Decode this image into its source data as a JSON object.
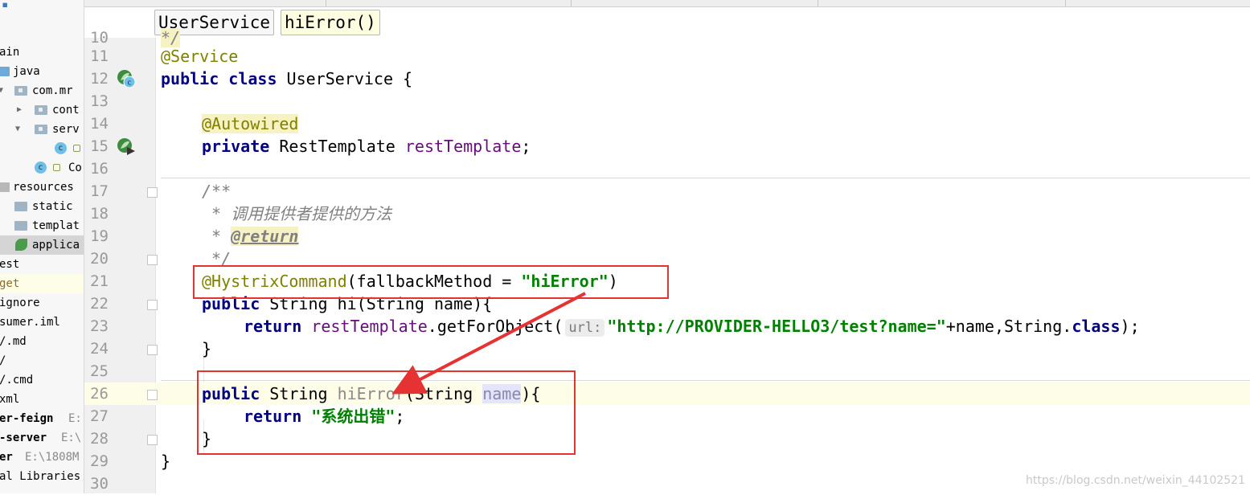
{
  "project_tree": [
    {
      "label": "ain",
      "icon": "none",
      "bold": false
    },
    {
      "label": "java",
      "icon": "source-folder-icon",
      "bold": false
    },
    {
      "label": "com.mr",
      "icon": "package-icon",
      "bold": false
    },
    {
      "label": "cont",
      "icon": "package-icon",
      "bold": false
    },
    {
      "label": "serv",
      "icon": "package-icon",
      "bold": false
    },
    {
      "label": "",
      "icon": "class-icon",
      "bold": false
    },
    {
      "label": "Co",
      "icon": "spring-boot-class-icon",
      "bold": false
    },
    {
      "label": "resources",
      "icon": "resources-folder-icon",
      "bold": false
    },
    {
      "label": "static",
      "icon": "folder-icon",
      "bold": false
    },
    {
      "label": "templat",
      "icon": "folder-icon",
      "bold": false
    },
    {
      "label": "applica",
      "icon": "spring-config-icon",
      "bold": false
    },
    {
      "label": "est",
      "icon": "none",
      "bold": false
    },
    {
      "label": "get",
      "icon": "none",
      "bold": false
    },
    {
      "label": "ignore",
      "icon": "none",
      "bold": false
    },
    {
      "label": "sumer.iml",
      "icon": "none",
      "bold": false
    },
    {
      "label": "/.md",
      "icon": "none",
      "bold": false
    },
    {
      "label": "/",
      "icon": "none",
      "bold": false
    },
    {
      "label": "/.cmd",
      "icon": "none",
      "bold": false
    },
    {
      "label": "xml",
      "icon": "none",
      "bold": false
    },
    {
      "label": "er-feign",
      "icon": "none",
      "bold": true,
      "path": "E:"
    },
    {
      "label": "-server",
      "icon": "none",
      "bold": true,
      "path": "E:\\"
    },
    {
      "label": "er",
      "icon": "none",
      "bold": true,
      "path": "E:\\1808M"
    },
    {
      "label": "al Libraries",
      "icon": "none",
      "bold": false
    }
  ],
  "breadcrumb": {
    "class_name": "UserService",
    "method_name": "hiError()"
  },
  "line_numbers": [
    "10",
    "11",
    "12",
    "13",
    "14",
    "15",
    "16",
    "17",
    "18",
    "19",
    "20",
    "21",
    "22",
    "23",
    "24",
    "25",
    "26",
    "27",
    "28",
    "29",
    "30"
  ],
  "code": {
    "l10": "*/",
    "l11_ann": "@Service",
    "l12_kw1": "public",
    "l12_kw2": "class",
    "l12_rest": " UserService {",
    "l14_ann": "@Autowired",
    "l15_kw": "private",
    "l15_type": " RestTemplate ",
    "l15_field": "restTemplate",
    "l15_end": ";",
    "l17": "/**",
    "l18": " * 调用提供者提供的方法",
    "l19_star": " * ",
    "l19_tag": "@return",
    "l20": " */",
    "l21_ann": "@HystrixCommand",
    "l21_mid": "(fallbackMethod = ",
    "l21_str": "\"hiError\"",
    "l21_end": ")",
    "l22_kw": "public",
    "l22_rest": " String hi(String name){",
    "l23_kw": "return",
    "l23_field": "restTemplate",
    "l23_mid": ".getForObject(",
    "l23_hint": "url:",
    "l23_str": "\"http://PROVIDER-HELLO3/test?name=\"",
    "l23_mid2": "+name,String.",
    "l23_kw2": "class",
    "l23_end": ");",
    "l24": "}",
    "l26_kw": "public",
    "l26_type": " String ",
    "l26_name": "hiError",
    "l26_mid": "(String ",
    "l26_param": "name",
    "l26_end": "){",
    "l27_kw": "return",
    "l27_str": "\"系统出错\"",
    "l27_end": ";",
    "l28": "}",
    "l29": "}"
  },
  "watermark": "https://blog.csdn.net/weixin_44102521"
}
